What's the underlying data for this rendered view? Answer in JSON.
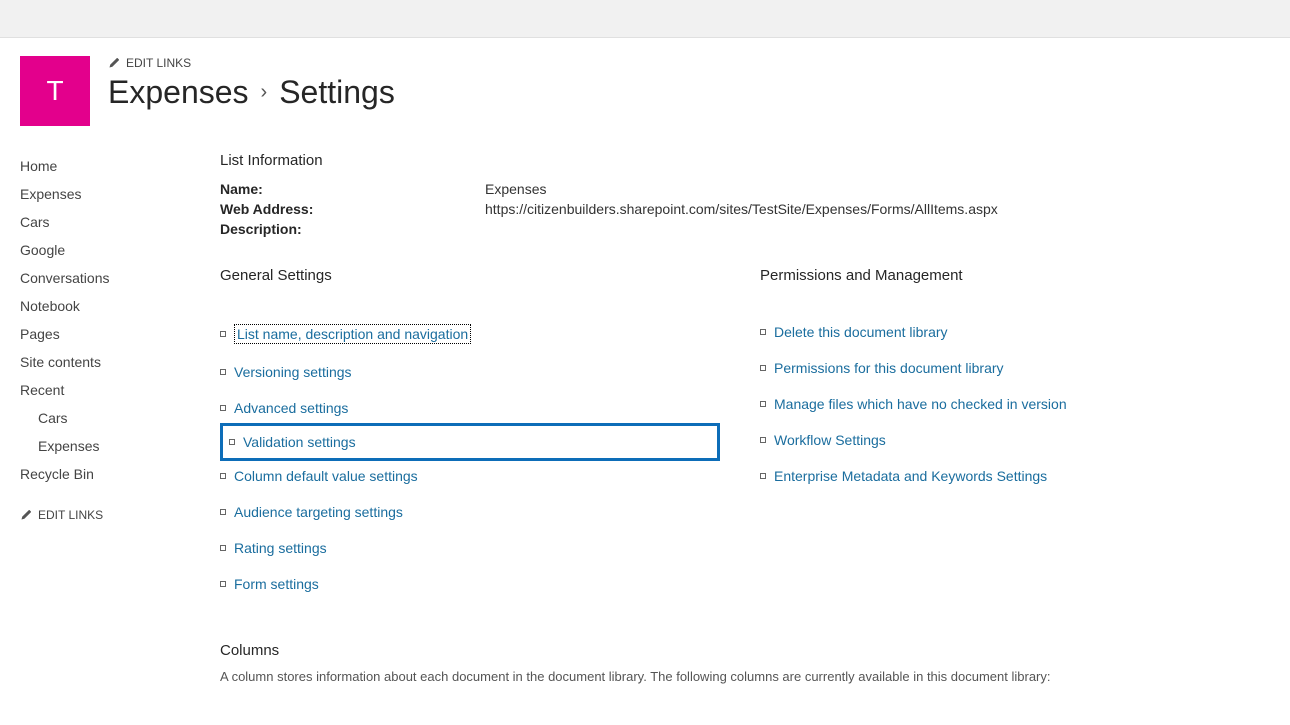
{
  "header": {
    "logo_letter": "T",
    "edit_links_label": "EDIT LINKS",
    "breadcrumb_parent": "Expenses",
    "breadcrumb_sep": "›",
    "breadcrumb_current": "Settings"
  },
  "left_nav": {
    "items": [
      {
        "label": "Home",
        "indent": false
      },
      {
        "label": "Expenses",
        "indent": false
      },
      {
        "label": "Cars",
        "indent": false
      },
      {
        "label": "Google",
        "indent": false
      },
      {
        "label": "Conversations",
        "indent": false
      },
      {
        "label": "Notebook",
        "indent": false
      },
      {
        "label": "Pages",
        "indent": false
      },
      {
        "label": "Site contents",
        "indent": false
      },
      {
        "label": "Recent",
        "indent": false
      },
      {
        "label": "Cars",
        "indent": true
      },
      {
        "label": "Expenses",
        "indent": true
      },
      {
        "label": "Recycle Bin",
        "indent": false
      }
    ],
    "edit_links_label": "EDIT LINKS"
  },
  "list_info": {
    "heading": "List Information",
    "name_label": "Name:",
    "name_value": "Expenses",
    "web_label": "Web Address:",
    "web_value": "https://citizenbuilders.sharepoint.com/sites/TestSite/Expenses/Forms/AllItems.aspx",
    "desc_label": "Description:"
  },
  "general": {
    "heading": "General Settings",
    "items": [
      "List name, description and navigation",
      "Versioning settings",
      "Advanced settings",
      "Validation settings",
      "Column default value settings",
      "Audience targeting settings",
      "Rating settings",
      "Form settings"
    ]
  },
  "permissions": {
    "heading": "Permissions and Management",
    "items": [
      "Delete this document library",
      "Permissions for this document library",
      "Manage files which have no checked in version",
      "Workflow Settings",
      "Enterprise Metadata and Keywords Settings"
    ]
  },
  "columns": {
    "heading": "Columns",
    "description": "A column stores information about each document in the document library. The following columns are currently available in this document library:"
  }
}
